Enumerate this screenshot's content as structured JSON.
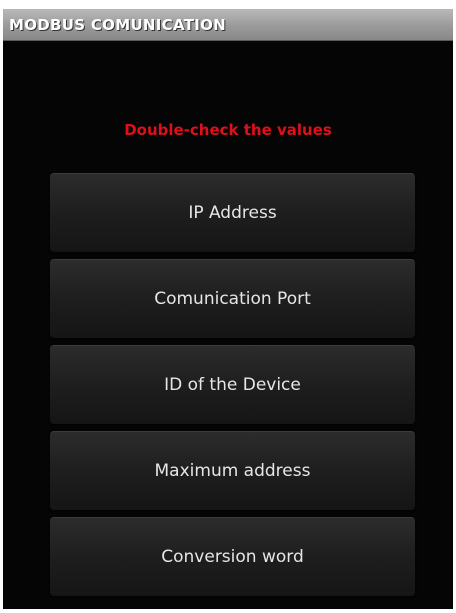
{
  "window": {
    "title": "MODBUS COMUNICATION"
  },
  "main": {
    "warning": "Double-check the values",
    "buttons": [
      {
        "label": "IP Address"
      },
      {
        "label": "Comunication Port"
      },
      {
        "label": "ID of the Device"
      },
      {
        "label": "Maximum address"
      },
      {
        "label": "Conversion word"
      }
    ]
  },
  "colors": {
    "warning_text": "#e0101a",
    "background": "#050505",
    "title_bar": "#9a9a9a"
  }
}
